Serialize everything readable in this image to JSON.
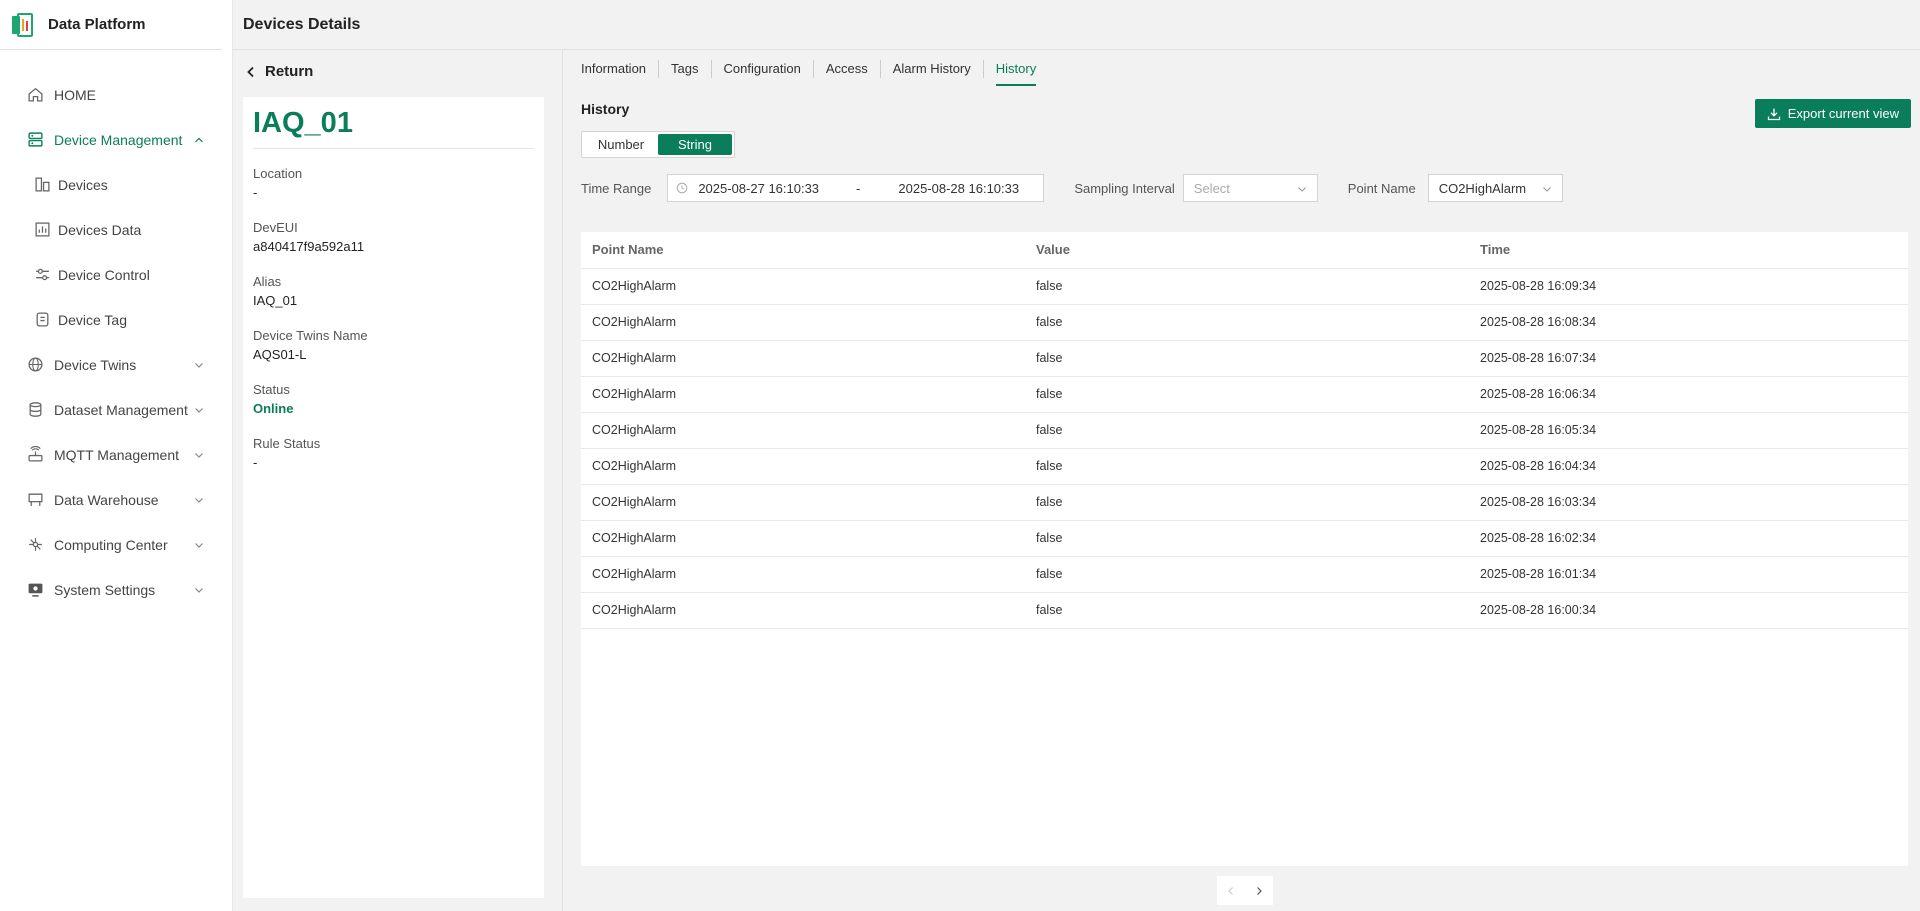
{
  "app": {
    "title": "Data Platform"
  },
  "header": {
    "title": "Devices Details"
  },
  "sidebar": {
    "items": [
      {
        "label": "HOME"
      },
      {
        "label": "Device Management"
      },
      {
        "label": "Devices"
      },
      {
        "label": "Devices Data"
      },
      {
        "label": "Device Control"
      },
      {
        "label": "Device Tag"
      },
      {
        "label": "Device Twins"
      },
      {
        "label": "Dataset Management"
      },
      {
        "label": "MQTT Management"
      },
      {
        "label": "Data Warehouse"
      },
      {
        "label": "Computing Center"
      },
      {
        "label": "System Settings"
      }
    ]
  },
  "details": {
    "return_label": "Return",
    "device_name": "IAQ_01",
    "fields": [
      {
        "label": "Location",
        "value": "-"
      },
      {
        "label": "DevEUI",
        "value": "a840417f9a592a11"
      },
      {
        "label": "Alias",
        "value": "IAQ_01"
      },
      {
        "label": "Device Twins Name",
        "value": "AQS01-L"
      },
      {
        "label": "Status",
        "value": "Online"
      },
      {
        "label": "Rule Status",
        "value": "-"
      }
    ]
  },
  "tabs": [
    "Information",
    "Tags",
    "Configuration",
    "Access",
    "Alarm History",
    "History"
  ],
  "history": {
    "title": "History",
    "export_label": "Export current view",
    "segments": [
      "Number",
      "String"
    ],
    "time_range_label": "Time Range",
    "time_start": "2025-08-27 16:10:33",
    "time_sep": "-",
    "time_end": "2025-08-28 16:10:33",
    "sampling_label": "Sampling Interval",
    "sampling_placeholder": "Select",
    "point_label": "Point Name",
    "point_value": "CO2HighAlarm"
  },
  "table": {
    "columns": [
      "Point Name",
      "Value",
      "Time"
    ],
    "rows": [
      [
        "CO2HighAlarm",
        "false",
        "2025-08-28 16:09:34"
      ],
      [
        "CO2HighAlarm",
        "false",
        "2025-08-28 16:08:34"
      ],
      [
        "CO2HighAlarm",
        "false",
        "2025-08-28 16:07:34"
      ],
      [
        "CO2HighAlarm",
        "false",
        "2025-08-28 16:06:34"
      ],
      [
        "CO2HighAlarm",
        "false",
        "2025-08-28 16:05:34"
      ],
      [
        "CO2HighAlarm",
        "false",
        "2025-08-28 16:04:34"
      ],
      [
        "CO2HighAlarm",
        "false",
        "2025-08-28 16:03:34"
      ],
      [
        "CO2HighAlarm",
        "false",
        "2025-08-28 16:02:34"
      ],
      [
        "CO2HighAlarm",
        "false",
        "2025-08-28 16:01:34"
      ],
      [
        "CO2HighAlarm",
        "false",
        "2025-08-28 16:00:34"
      ]
    ]
  },
  "colors": {
    "accent": "#0a7d5a",
    "background": "#f2f2f2"
  }
}
